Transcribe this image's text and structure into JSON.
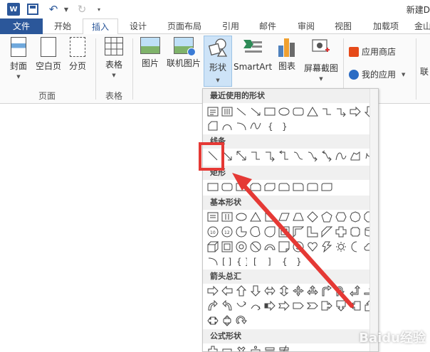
{
  "titlebar": {
    "logo_letter": "W",
    "doc_title": "新建D"
  },
  "tabs": [
    "文件",
    "开始",
    "插入",
    "设计",
    "页面布局",
    "引用",
    "邮件",
    "审阅",
    "视图",
    "加载项",
    "金山"
  ],
  "ribbon": {
    "pages_group": {
      "cover": "封面",
      "blank": "空白页",
      "break": "分页",
      "label": "页面"
    },
    "table_group": {
      "table": "表格",
      "label": "表格"
    },
    "illus_group": {
      "picture": "图片",
      "online_picture": "联机图片",
      "shapes": "形状",
      "smartart": "SmartArt",
      "chart": "图表",
      "screenshot": "屏幕截图"
    },
    "apps_group": {
      "store": "应用商店",
      "myapps": "我的应用"
    },
    "right_cut": "联"
  },
  "shapes_panel": {
    "recent": "最近使用的形状",
    "lines": "线条",
    "rects": "矩形",
    "basic": "基本形状",
    "arrows": "箭头总汇",
    "equation": "公式形状"
  },
  "colors": {
    "brand": "#2b579a",
    "annotation": "#e53935"
  },
  "watermark": "Baidu经验"
}
